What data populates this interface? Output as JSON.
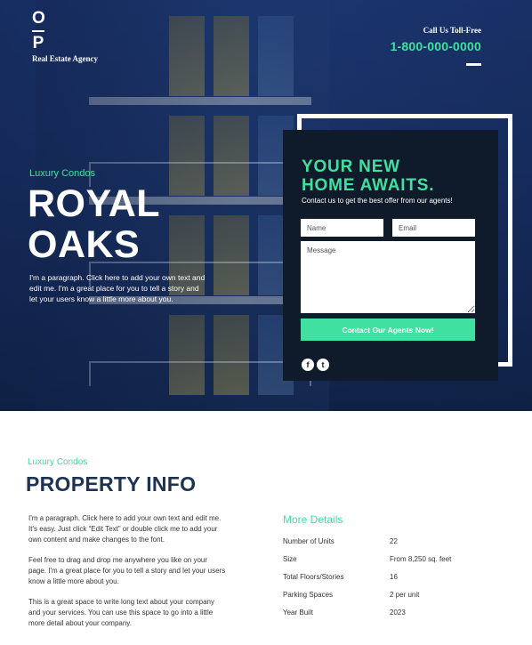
{
  "header": {
    "logo_top": "O",
    "logo_bottom": "P",
    "agency_name": "Real Estate Agency",
    "call_label": "Call Us Toll-Free",
    "phone": "1-800-000-0000"
  },
  "hero": {
    "kicker": "Luxury Condos",
    "title_line1": "ROYAL",
    "title_line2": "OAKS",
    "paragraph": "I'm a paragraph. Click here to add your own text and edit me. I'm a great place for you to tell a story and let your users know a little more about you."
  },
  "form": {
    "title_line1": "YOUR NEW",
    "title_line2": "HOME AWAITS.",
    "subtitle": "Contact us to get the best offer from our agents!",
    "name_placeholder": "Name",
    "email_placeholder": "Email",
    "message_placeholder": "Message",
    "submit_label": "Contact Our Agents Now!",
    "social": [
      "f",
      "t"
    ]
  },
  "property": {
    "kicker": "Luxury Condos",
    "title": "PROPERTY INFO",
    "paragraphs": [
      "I'm a paragraph. Click here to add your own text and edit me. It's easy. Just click “Edit Text” or double click me to add your own content and make changes to the font.",
      "Feel free to drag and drop me anywhere you like on your page. I'm a great place for you to tell a story and let your users know a little more about you.",
      "This is a great space to write long text about your company and your services. You can use this space to go into a little more detail about your company."
    ],
    "details_title": "More Details",
    "details": [
      {
        "label": "Number of Units",
        "value": "22"
      },
      {
        "label": "Size",
        "value": "From 8,250 sq. feet"
      },
      {
        "label": "Total Floors/Stories",
        "value": "16"
      },
      {
        "label": "Parking Spaces",
        "value": "2 per unit"
      },
      {
        "label": "Year Built",
        "value": "2023"
      }
    ]
  },
  "colors": {
    "accent": "#3fe0a0",
    "navy": "#1d3353",
    "panel": "#0f1b2a"
  }
}
